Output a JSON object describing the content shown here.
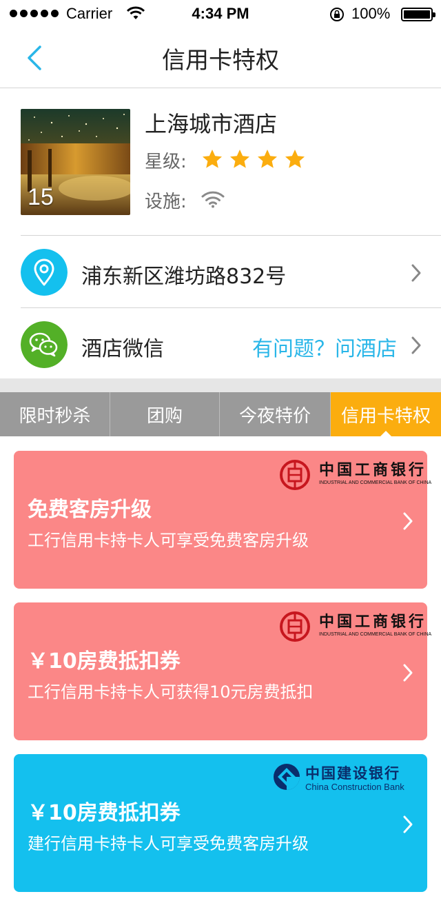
{
  "status_bar": {
    "carrier": "Carrier",
    "time": "4:34 PM",
    "battery": "100%"
  },
  "nav": {
    "title": "信用卡特权"
  },
  "hotel": {
    "name": "上海城市酒店",
    "photo_count": "15",
    "star_label": "星级:",
    "stars": 4,
    "facility_label": "设施:",
    "facilities": [
      "wifi-icon"
    ]
  },
  "address": {
    "text": "浦东新区潍坊路832号"
  },
  "wechat": {
    "label": "酒店微信",
    "link": "有问题？问酒店"
  },
  "tabs": [
    {
      "label": "限时秒杀",
      "active": false
    },
    {
      "label": "团购",
      "active": false
    },
    {
      "label": "今夜特价",
      "active": false
    },
    {
      "label": "信用卡特权",
      "active": true
    }
  ],
  "offers": [
    {
      "bank": "中国工商银行",
      "bank_en": "INDUSTRIAL AND COMMERCIAL BANK OF CHINA",
      "title": "免费客房升级",
      "desc": "工行信用卡持卡人可享受免费客房升级",
      "color": "#fb8787"
    },
    {
      "bank": "中国工商银行",
      "bank_en": "INDUSTRIAL AND COMMERCIAL BANK OF CHINA",
      "title": "￥10房费抵扣券",
      "desc": "工行信用卡持卡人可获得10元房费抵扣",
      "color": "#fb8787"
    },
    {
      "bank": "中国建设银行",
      "bank_en": "China Construction Bank",
      "title": "￥10房费抵扣券",
      "desc": "建行信用卡持卡人可享受免费客房升级",
      "color": "#14c0ee"
    }
  ],
  "colors": {
    "accent": "#29b6e8",
    "tab_active": "#fbad0f",
    "tab_inactive": "#9a9a9a",
    "star": "#fbad0f",
    "wechat": "#53b027",
    "icbc_card": "#fb8787",
    "ccb_card": "#14c0ee"
  }
}
